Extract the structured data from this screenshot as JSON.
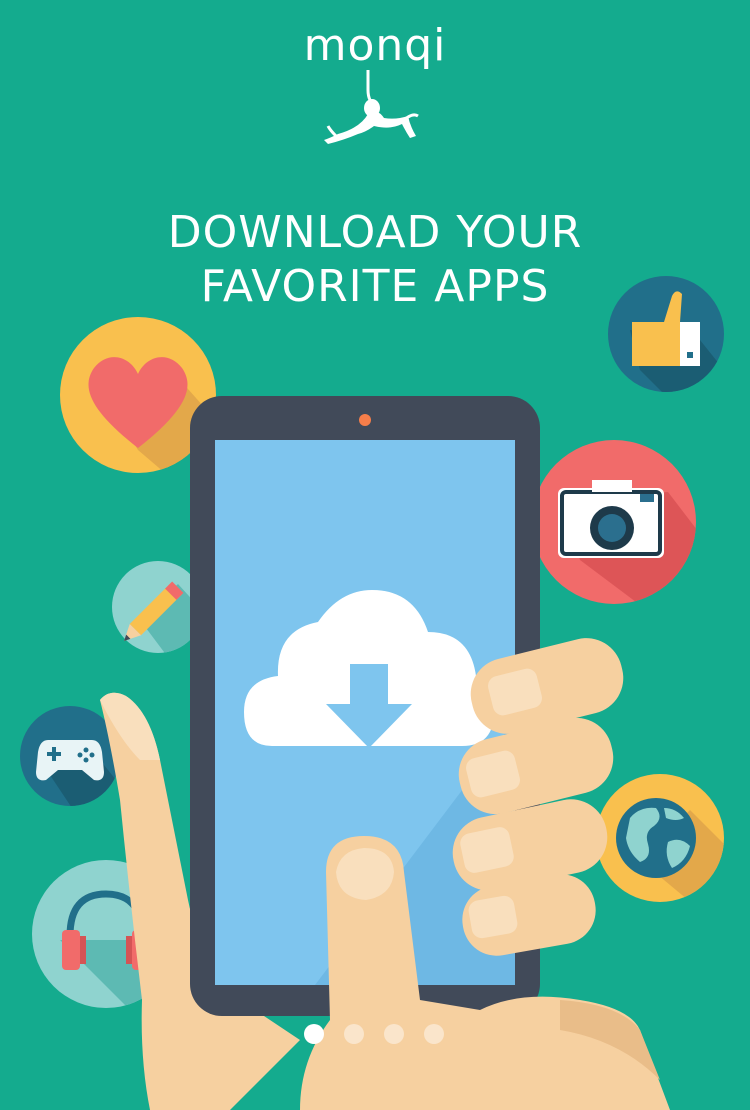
{
  "brand": {
    "logo_text": "monqi"
  },
  "headline": {
    "line1": "DOWNLOAD YOUR",
    "line2": "FAVORITE APPS"
  },
  "icons": [
    "heart-icon",
    "thumbs-up-icon",
    "camera-icon",
    "pencil-icon",
    "gamepad-icon",
    "globe-icon",
    "headphones-icon",
    "cloud-download-icon"
  ],
  "pager": {
    "total": 4,
    "active_index": 0
  },
  "colors": {
    "background": "#14ab8e",
    "phone_body": "#414a59",
    "screen": "#7ec5ee",
    "skin": "#f6d0a0"
  }
}
